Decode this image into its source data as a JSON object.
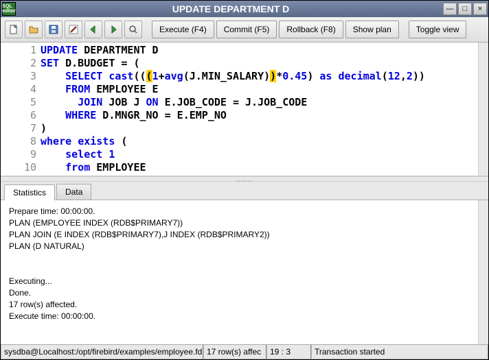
{
  "window": {
    "title": "UPDATE DEPARTMENT D",
    "icon_text": "SQL\neditor"
  },
  "toolbar": {
    "execute": "Execute (F4)",
    "commit": "Commit (F5)",
    "rollback": "Rollback (F8)",
    "show_plan": "Show plan",
    "toggle_view": "Toggle view"
  },
  "code": {
    "lines": [
      {
        "n": 1,
        "tokens": [
          [
            "UPDATE",
            "kw-blue"
          ],
          [
            " DEPARTMENT D",
            "kw-black"
          ]
        ]
      },
      {
        "n": 2,
        "tokens": [
          [
            "SET",
            "kw-blue"
          ],
          [
            " D.BUDGET = (",
            "kw-black"
          ]
        ]
      },
      {
        "n": 3,
        "tokens": [
          [
            "    ",
            "kw-black"
          ],
          [
            "SELECT",
            "kw-blue"
          ],
          [
            " ",
            "kw-black"
          ],
          [
            "cast",
            "kw-blue"
          ],
          [
            "((",
            "kw-black"
          ],
          [
            "(",
            "hl"
          ],
          [
            "1",
            "num"
          ],
          [
            "+",
            "kw-black"
          ],
          [
            "avg",
            "kw-blue"
          ],
          [
            "(J.MIN_SALARY)",
            "kw-black"
          ],
          [
            ")",
            "hl"
          ],
          [
            "*",
            "kw-black"
          ],
          [
            "0.45",
            "num"
          ],
          [
            ") ",
            "kw-black"
          ],
          [
            "as",
            "kw-blue"
          ],
          [
            " ",
            "kw-black"
          ],
          [
            "decimal",
            "kw-blue"
          ],
          [
            "(",
            "kw-black"
          ],
          [
            "12",
            "num"
          ],
          [
            ",",
            "kw-black"
          ],
          [
            "2",
            "num"
          ],
          [
            "))",
            "kw-black"
          ]
        ]
      },
      {
        "n": 4,
        "tokens": [
          [
            "    ",
            "kw-black"
          ],
          [
            "FROM",
            "kw-blue"
          ],
          [
            " EMPLOYEE E",
            "kw-black"
          ]
        ]
      },
      {
        "n": 5,
        "tokens": [
          [
            "      ",
            "kw-black"
          ],
          [
            "JOIN",
            "kw-blue"
          ],
          [
            " JOB J ",
            "kw-black"
          ],
          [
            "ON",
            "kw-blue"
          ],
          [
            " E.JOB_CODE = J.JOB_CODE",
            "kw-black"
          ]
        ]
      },
      {
        "n": 6,
        "tokens": [
          [
            "    ",
            "kw-black"
          ],
          [
            "WHERE",
            "kw-blue"
          ],
          [
            " D.MNGR_NO = E.EMP_NO",
            "kw-black"
          ]
        ]
      },
      {
        "n": 7,
        "tokens": [
          [
            ")",
            "kw-black"
          ]
        ]
      },
      {
        "n": 8,
        "tokens": [
          [
            "where",
            "kw-blue"
          ],
          [
            " ",
            "kw-black"
          ],
          [
            "exists",
            "kw-blue"
          ],
          [
            " (",
            "kw-black"
          ]
        ]
      },
      {
        "n": 9,
        "tokens": [
          [
            "    ",
            "kw-black"
          ],
          [
            "select",
            "kw-blue"
          ],
          [
            " ",
            "kw-black"
          ],
          [
            "1",
            "num"
          ]
        ]
      },
      {
        "n": 10,
        "tokens": [
          [
            "    ",
            "kw-black"
          ],
          [
            "from",
            "kw-blue"
          ],
          [
            " EMPLOYEE",
            "kw-black"
          ]
        ]
      }
    ]
  },
  "tabs": {
    "stats": "Statistics",
    "data": "Data"
  },
  "stats": {
    "text": "Prepare time: 00:00:00.\nPLAN (EMPLOYEE INDEX (RDB$PRIMARY7))\nPLAN JOIN (E INDEX (RDB$PRIMARY7),J INDEX (RDB$PRIMARY2))\nPLAN (D NATURAL)\n\n\nExecuting...\nDone.\n17 row(s) affected.\nExecute time: 00:00:00."
  },
  "status": {
    "connection": "sysdba@Localhost:/opt/firebird/examples/employee.fdb",
    "rows": "17 row(s) affec",
    "cursor": "19 : 3",
    "txn": "Transaction started"
  }
}
